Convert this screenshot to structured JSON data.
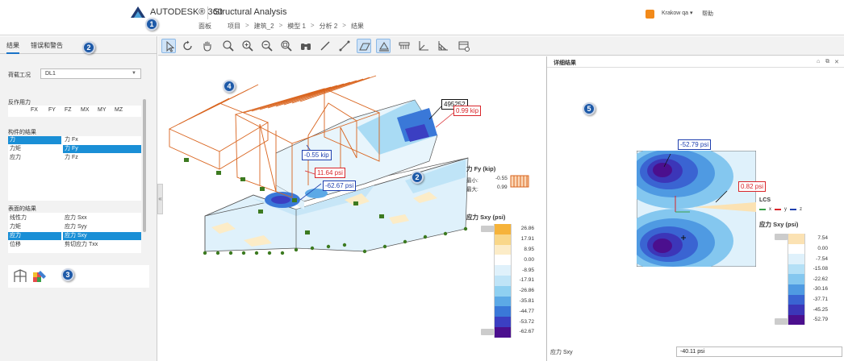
{
  "header": {
    "brand": "AUTODESK® 360",
    "product": "Structural Analysis",
    "breadcrumbs": [
      "面板",
      "项目",
      "建筑_2",
      "模型 1",
      "分析 2",
      "结果"
    ],
    "user": "Krakow qa ▾",
    "help": "帮助"
  },
  "callouts": [
    "1",
    "2",
    "3",
    "4",
    "2",
    "5"
  ],
  "left_panel": {
    "tabs": [
      "结果",
      "错误和警告"
    ],
    "load_case_label": "荷载工况",
    "load_case_value": "DL1",
    "reactions_title": "反作用力",
    "reaction_columns": [
      "FX",
      "FY",
      "FZ",
      "MX",
      "MY",
      "MZ"
    ],
    "member_results_title": "构件的结果",
    "member_left": [
      "力",
      "力矩",
      "应力"
    ],
    "member_right": [
      "力 Fx",
      "力 Fy",
      "力 Fz"
    ],
    "surface_results_title": "表面的结果",
    "surface_left": [
      "线性力",
      "力矩",
      "应力",
      "位移"
    ],
    "surface_right": [
      "应力 Sxx",
      "应力 Syy",
      "应力 Sxy",
      "剪切应力 Txx"
    ],
    "tool_icons": [
      "frame-icon",
      "paint-bucket-icon"
    ]
  },
  "toolbar": {
    "icons": [
      "select-icon",
      "rotate-icon",
      "pan-icon",
      "zoom-icon",
      "zoom-in-icon",
      "zoom-out-icon",
      "zoom-extents-icon",
      "binoculars-icon",
      "member-icon",
      "member-line-icon",
      "panel-icon",
      "support-icon",
      "load-icon",
      "axis-icon",
      "mesh-icon",
      "settings-icon"
    ]
  },
  "viewport": {
    "labels": {
      "top_value": "495252",
      "top_red": "0.99 kip",
      "mid_blue": "-0.55 kip",
      "mid_red": "11.64 psi",
      "lower_blue": "-62.67 psi"
    },
    "force_legend": {
      "title": "力 Fy (kip)",
      "min_label": "最小:",
      "min_value": "-0.55",
      "max_label": "最大:",
      "max_value": "0.99"
    },
    "stress_legend": {
      "title": "应力 Sxy (psi)",
      "values": [
        "26.86",
        "17.91",
        "8.95",
        "0.00",
        "-8.95",
        "-17.91",
        "-26.86",
        "-35.81",
        "-44.77",
        "-53.72",
        "-62.67"
      ],
      "colors": [
        "#f6b33a",
        "#f9d789",
        "#fcecc7",
        "#ffffff",
        "#dff1fb",
        "#bfe4f7",
        "#8fd0f1",
        "#5ca9e6",
        "#3a78d8",
        "#3b3fc2",
        "#4b0f8e"
      ]
    }
  },
  "detail": {
    "title": "详细结果",
    "window_controls": [
      "⌂",
      "⧉",
      "✕"
    ],
    "label_top": "-52.79 psi",
    "label_right": "0.82 psi",
    "lcs_title": "LCS",
    "lcs_axes": [
      "x",
      "y",
      "z"
    ],
    "legend_title": "应力 Sxy (psi)",
    "legend_values": [
      "7.54",
      "0.00",
      "-7.54",
      "-15.08",
      "-22.62",
      "-30.16",
      "-37.71",
      "-45.25",
      "-52.79"
    ],
    "legend_colors": [
      "#fbe2b3",
      "#ffffff",
      "#dff1fb",
      "#b4e0f6",
      "#84c7ef",
      "#4f9ae2",
      "#3a64d2",
      "#3c36b8",
      "#4b0f8e"
    ],
    "footer_label": "应力 Sxy",
    "footer_value": "-40.11 psi"
  }
}
